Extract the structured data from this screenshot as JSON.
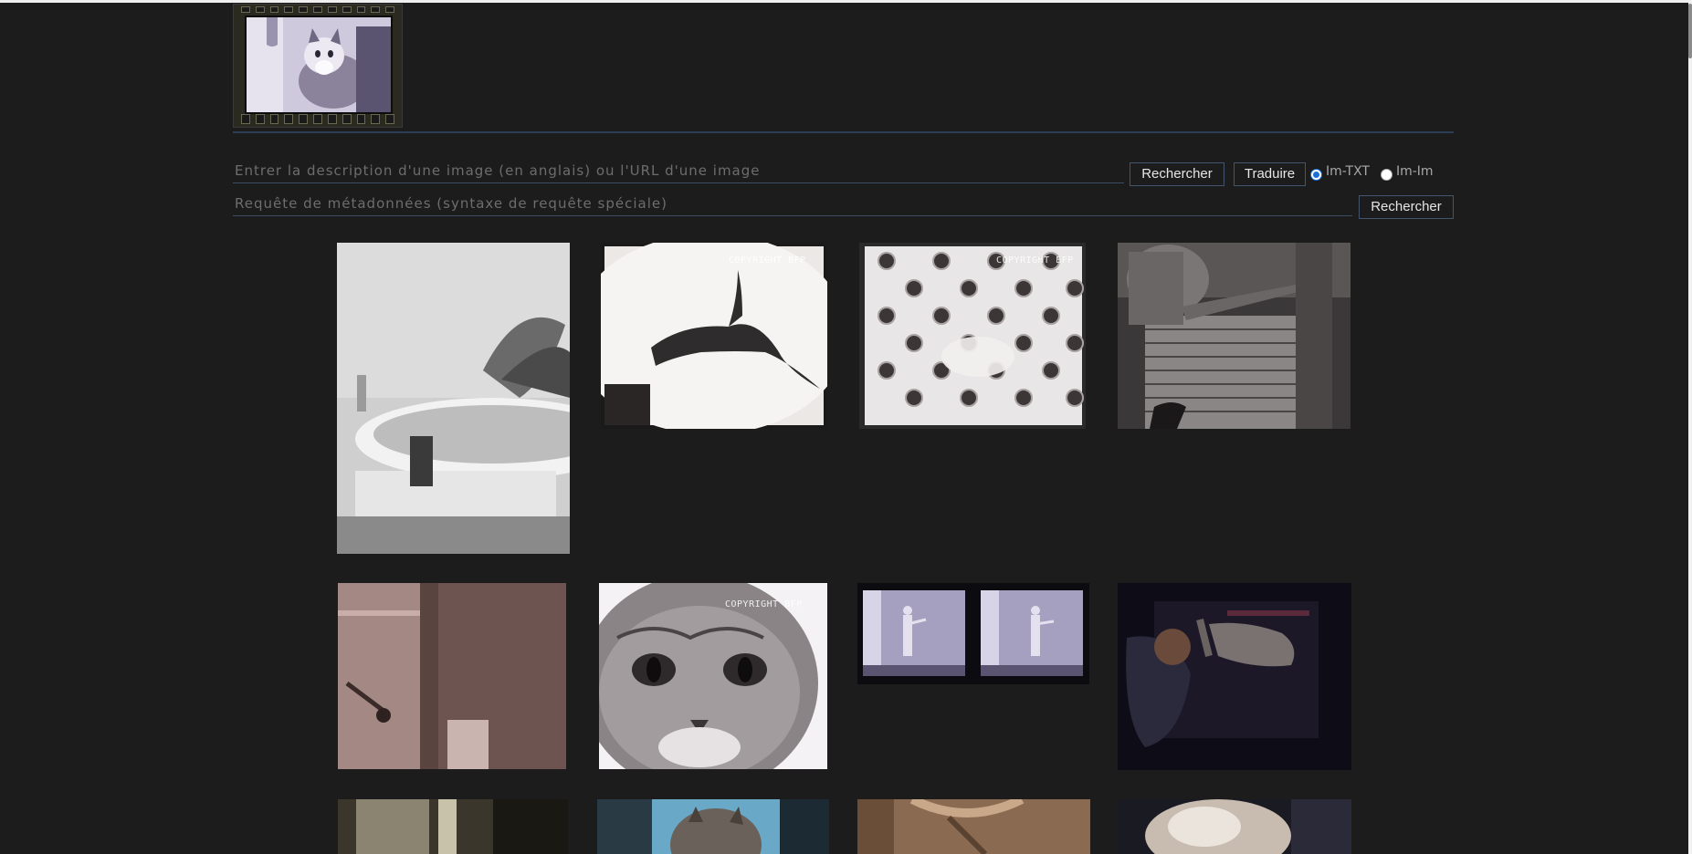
{
  "logo": {
    "name": "cat-filmstrip-logo"
  },
  "search": {
    "description_placeholder": "Entrer la description d'une image (en anglais) ou l'URL d'une image",
    "search_button_label": "Rechercher",
    "translate_button_label": "Traduire",
    "mode_options": [
      {
        "label": "Im-TXT",
        "selected": true
      },
      {
        "label": "Im-Im",
        "selected": false
      }
    ]
  },
  "metadata_search": {
    "placeholder": "Requête de métadonnées (syntaxe de requête spéciale)",
    "search_button_label": "Rechercher"
  },
  "results": {
    "watermark": "COPYRIGHT BFP",
    "items": [
      {
        "name": "result-bathtub-with-plant"
      },
      {
        "name": "result-cat-jumping-silhouette"
      },
      {
        "name": "result-cat-on-patterned-floor"
      },
      {
        "name": "result-watering-can-on-grate"
      },
      {
        "name": "result-shower-interior"
      },
      {
        "name": "result-cat-face-closeup"
      },
      {
        "name": "result-two-frame-figure-strip"
      },
      {
        "name": "result-cat-held-upside-down"
      },
      {
        "name": "result-dark-doorway"
      },
      {
        "name": "result-cat-blue-background"
      },
      {
        "name": "result-fabric-closeup"
      },
      {
        "name": "result-blurred-white-cat"
      }
    ]
  },
  "colors": {
    "background": "#1c1c1c",
    "accent_line": "#2c3e55",
    "button_border": "#43556d",
    "radio_selected": "#1a6fd8"
  }
}
